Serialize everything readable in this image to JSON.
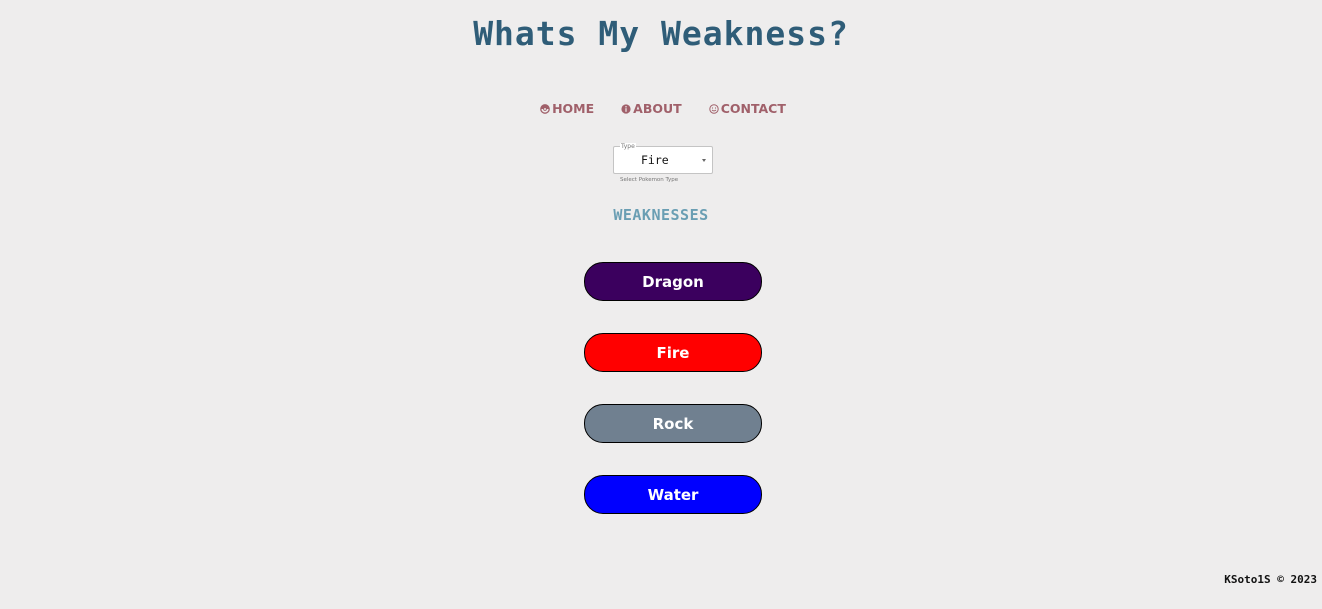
{
  "header": {
    "title": "Whats My Weakness?"
  },
  "nav": {
    "items": [
      {
        "label": "HOME",
        "icon": "pokeball-icon"
      },
      {
        "label": "ABOUT",
        "icon": "info-icon"
      },
      {
        "label": "CONTACT",
        "icon": "smiley-icon"
      }
    ],
    "color": "#a0606a"
  },
  "type_select": {
    "legend": "Type",
    "value": "Fire",
    "helper": "Select Pokemon Type"
  },
  "weaknesses": {
    "heading": "WEAKNESSES",
    "items": [
      {
        "label": "Dragon",
        "color": "#3b005e"
      },
      {
        "label": "Fire",
        "color": "#ff0000"
      },
      {
        "label": "Rock",
        "color": "#708090"
      },
      {
        "label": "Water",
        "color": "#0000ff"
      }
    ]
  },
  "footer": {
    "text": "KSoto1S © 2023"
  }
}
